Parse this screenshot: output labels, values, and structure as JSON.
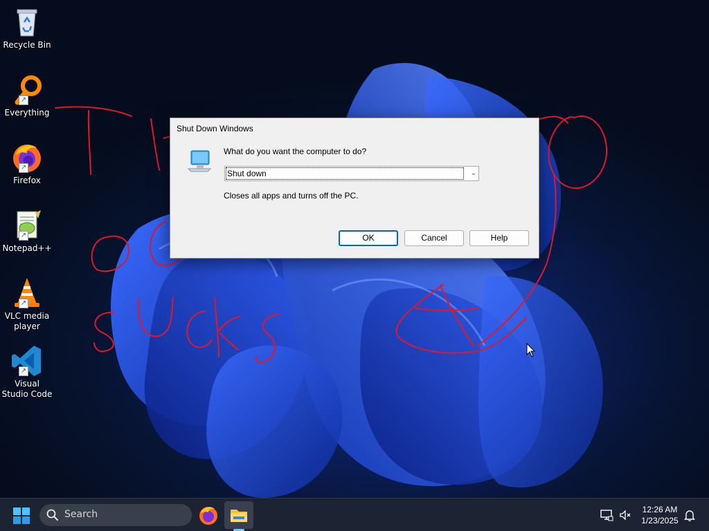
{
  "desktop": {
    "icons": [
      {
        "label": "Recycle Bin",
        "icon": "recycle-bin-icon"
      },
      {
        "label": "Everything",
        "icon": "everything-search-icon"
      },
      {
        "label": "Firefox",
        "icon": "firefox-icon"
      },
      {
        "label": "Notepad++",
        "icon": "notepad-plus-plus-icon"
      },
      {
        "label": "VLC media player",
        "icon": "vlc-icon"
      },
      {
        "label": "Visual Studio Code",
        "icon": "vscode-icon"
      }
    ],
    "scribble_color": "#e0182a"
  },
  "dialog": {
    "title": "Shut Down Windows",
    "question": "What do you want the computer to do?",
    "selected_option": "Shut down",
    "description": "Closes all apps and turns off the PC.",
    "buttons": {
      "ok": "OK",
      "cancel": "Cancel",
      "help": "Help"
    }
  },
  "taskbar": {
    "search_placeholder": "Search",
    "pinned": [
      "firefox-icon",
      "file-explorer-icon"
    ],
    "clock": {
      "time": "12:26 AM",
      "date": "1/23/2025"
    },
    "accent": "#60cdff"
  }
}
